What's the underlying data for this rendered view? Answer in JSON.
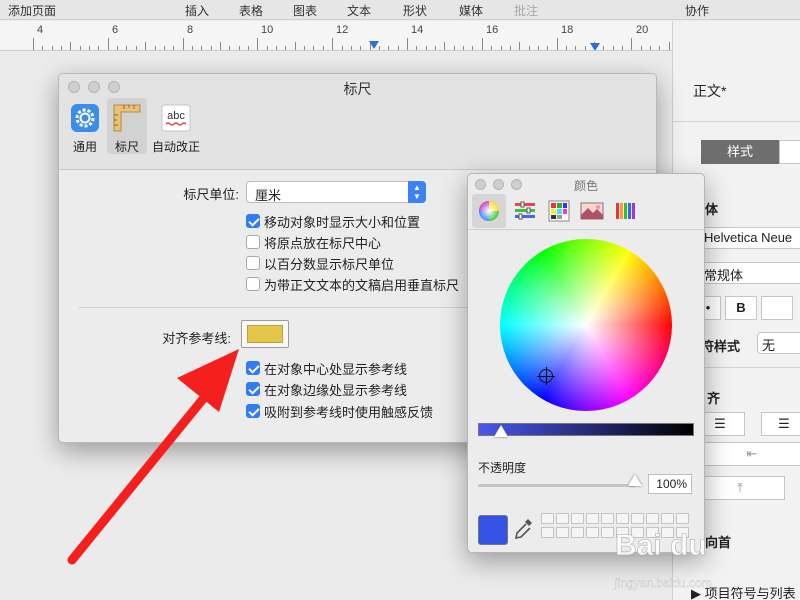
{
  "toolbar": {
    "items": [
      "添加页面",
      "插入",
      "表格",
      "图表",
      "文本",
      "形状",
      "媒体",
      "批注",
      "协作"
    ]
  },
  "ruler": {
    "numbers": [
      "4",
      "6",
      "8",
      "10",
      "12",
      "14",
      "16",
      "18",
      "20"
    ]
  },
  "prefs_window": {
    "title": "标尺",
    "tabs": [
      {
        "label": "通用",
        "icon": "gear-icon"
      },
      {
        "label": "标尺",
        "icon": "ruler-icon"
      },
      {
        "label": "自动改正",
        "icon": "autocorrect-icon",
        "icon_text": "abc"
      }
    ],
    "ruler_units_label": "标尺单位:",
    "ruler_units_value": "厘米",
    "unit_options": [
      {
        "label": "移动对象时显示大小和位置",
        "checked": true
      },
      {
        "label": "将原点放在标尺中心",
        "checked": false
      },
      {
        "label": "以百分数显示标尺单位",
        "checked": false
      },
      {
        "label": "为带正文文本的文稿启用垂直标尺",
        "checked": false
      }
    ],
    "guides_label": "对齐参考线:",
    "guide_color": "#e3c64a",
    "guide_options": [
      {
        "label": "在对象中心处显示参考线",
        "checked": true
      },
      {
        "label": "在对象边缘处显示参考线",
        "checked": true
      },
      {
        "label": "吸附到参考线时使用触感反馈",
        "checked": true
      }
    ]
  },
  "colors_panel": {
    "title": "颜色",
    "tabs": [
      "color-wheel-icon",
      "color-sliders-icon",
      "color-palettes-icon",
      "image-palettes-icon",
      "pencils-icon"
    ],
    "opacity_label": "不透明度",
    "opacity_value": "100%",
    "brightness": 0.1,
    "current_color": "#3452e3"
  },
  "inspector": {
    "style_name": "正文*",
    "style_tab": "样式",
    "font_heading": "体",
    "font_name": "Helvetica Neue",
    "font_style": "常规体",
    "bold_label": "B",
    "char_style_label": "符样式",
    "char_style_value": "无",
    "align_heading": "齐",
    "bullets_label": "项目符号与列表",
    "bottom_label": "向首"
  },
  "watermark": {
    "text": "Bai du",
    "sub": "jingyan.baidu.com"
  },
  "accent_colors": {
    "arrow": "#f5201e",
    "checkbox": "#2f7cf6"
  }
}
